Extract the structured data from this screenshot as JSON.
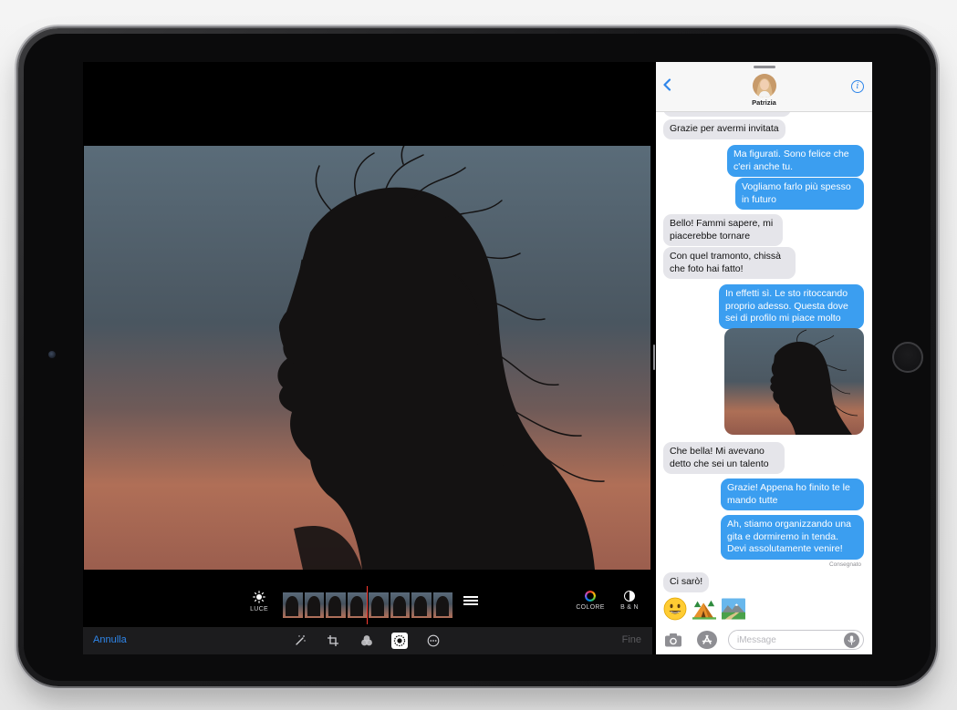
{
  "photos": {
    "cancel_label": "Annulla",
    "done_label": "Fine",
    "light_label": "LUCE",
    "color_label": "COLORE",
    "bw_label": "B & N"
  },
  "messages": {
    "contact_name": "Patrizia",
    "thread": [
      {
        "dir": "recv",
        "text": "Grazie per avermi invitata"
      },
      {
        "dir": "sent",
        "text": "Ma figurati. Sono felice che c'eri anche tu."
      },
      {
        "dir": "sent",
        "text": "Vogliamo farlo più spesso in futuro"
      },
      {
        "dir": "recv",
        "text": "Bello! Fammi sapere, mi piacerebbe tornare"
      },
      {
        "dir": "recv",
        "text": "Con quel tramonto, chissà che foto hai fatto!"
      },
      {
        "dir": "sent",
        "text": "In effetti sì. Le sto ritoccando proprio adesso. Questa dove sei di profilo mi piace molto"
      },
      {
        "dir": "recv",
        "text": "Che bella! Mi avevano detto che sei un talento"
      },
      {
        "dir": "sent",
        "text": "Grazie! Appena ho finito te le mando tutte"
      },
      {
        "dir": "sent",
        "text": "Ah, stiamo organizzando una gita e dormiremo in tenda. Devi assolutamente venire!"
      },
      {
        "dir": "recv",
        "text": "Ci sarò!"
      }
    ],
    "delivered_label": "Consegnato",
    "input_placeholder": "iMessage"
  },
  "colors": {
    "accent_blue": "#2f86ea",
    "sent_bubble": "#3b9ef0",
    "recv_bubble": "#e5e5ea",
    "playhead": "#ff3b30"
  }
}
